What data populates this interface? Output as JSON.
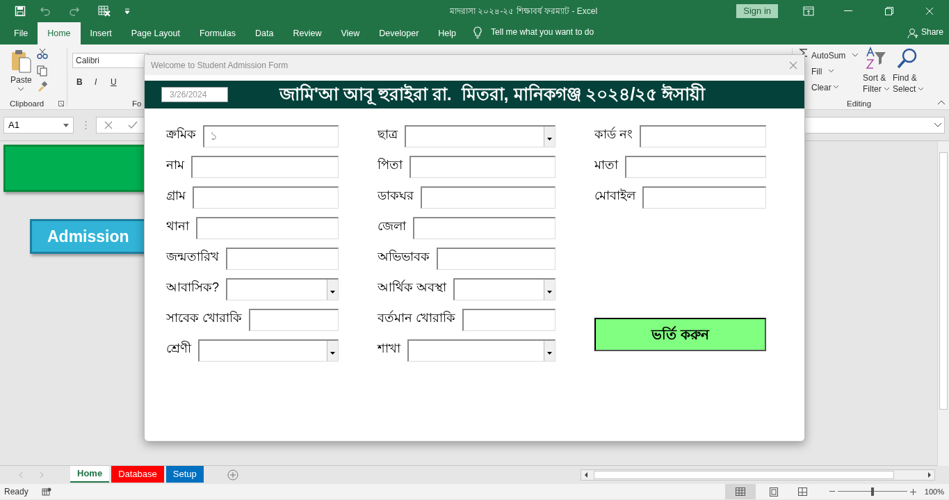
{
  "window": {
    "title": "মাদরাসা ২০২৪-২৫ শিক্ষাবর্ষ ফরম্যাট  -  Excel",
    "sign_in": "Sign in"
  },
  "ribbon_tabs": [
    {
      "label": "File",
      "selected": false
    },
    {
      "label": "Home",
      "selected": true
    },
    {
      "label": "Insert",
      "selected": false
    },
    {
      "label": "Page Layout",
      "selected": false
    },
    {
      "label": "Formulas",
      "selected": false
    },
    {
      "label": "Data",
      "selected": false
    },
    {
      "label": "Review",
      "selected": false
    },
    {
      "label": "View",
      "selected": false
    },
    {
      "label": "Developer",
      "selected": false
    },
    {
      "label": "Help",
      "selected": false
    }
  ],
  "tell_me": "Tell me what you want to do",
  "share": "Share",
  "ribbon": {
    "paste": "Paste",
    "clipboard": "Clipboard",
    "font_name": "Calibri",
    "font_group": "Fo",
    "bold": "B",
    "italic": "I",
    "underline": "U",
    "autosum": "AutoSum",
    "fill": "Fill",
    "clear": "Clear",
    "sort_filter": [
      "Sort &",
      "Filter"
    ],
    "find_select": [
      "Find &",
      "Select"
    ],
    "editing": "Editing"
  },
  "formula_bar": {
    "name_box": "A1"
  },
  "sheet": {
    "admission_button": "Admission"
  },
  "dialog": {
    "title": "Welcome to Student Admission Form",
    "date": "3/26/2024",
    "heading": "জামি'আ আবূ হুরাইরা রা.  মিতরা, মানিকগঞ্জ ২০২৪/২৫ ঈসায়ী",
    "rows": [
      [
        {
          "label": "ক্রমিক",
          "kind": "text",
          "value": "১"
        },
        {
          "label": "ছাত্র",
          "kind": "dropdown"
        },
        {
          "label": "কার্ড নং",
          "kind": "text"
        }
      ],
      [
        {
          "label": "নাম",
          "kind": "text"
        },
        {
          "label": "পিতা",
          "kind": "text"
        },
        {
          "label": "মাতা",
          "kind": "text"
        }
      ],
      [
        {
          "label": "গ্রাম",
          "kind": "text"
        },
        {
          "label": "ডাকঘর",
          "kind": "text"
        },
        {
          "label": "মোবাইল",
          "kind": "text"
        }
      ],
      [
        {
          "label": "থানা",
          "kind": "text"
        },
        {
          "label": "জেলা",
          "kind": "text"
        }
      ],
      [
        {
          "label": "জন্মতারিখ",
          "kind": "text"
        },
        {
          "label": "অভিভাবক",
          "kind": "text"
        }
      ],
      [
        {
          "label": "আবাসিক?",
          "kind": "dropdown"
        },
        {
          "label": "আর্থিক অবস্থা",
          "kind": "dropdown"
        }
      ],
      [
        {
          "label": "সাবেক খোরাকি",
          "kind": "text"
        },
        {
          "label": "বর্তমান খোরাকি",
          "kind": "text"
        }
      ],
      [
        {
          "label": "শ্রেণী",
          "kind": "dropdown"
        },
        {
          "label": "শাখা",
          "kind": "dropdown"
        }
      ]
    ],
    "submit": "ভর্তি করুন"
  },
  "sheet_tabs": [
    {
      "label": "Home",
      "selected": true,
      "color": "#ffffff"
    },
    {
      "label": "Database",
      "selected": false,
      "color": "#ff0000"
    },
    {
      "label": "Setup",
      "selected": false,
      "color": "#0070c0"
    }
  ],
  "status": {
    "ready": "Ready",
    "zoom": "100%",
    "zoom_slider": {
      "level": 0.5
    }
  }
}
